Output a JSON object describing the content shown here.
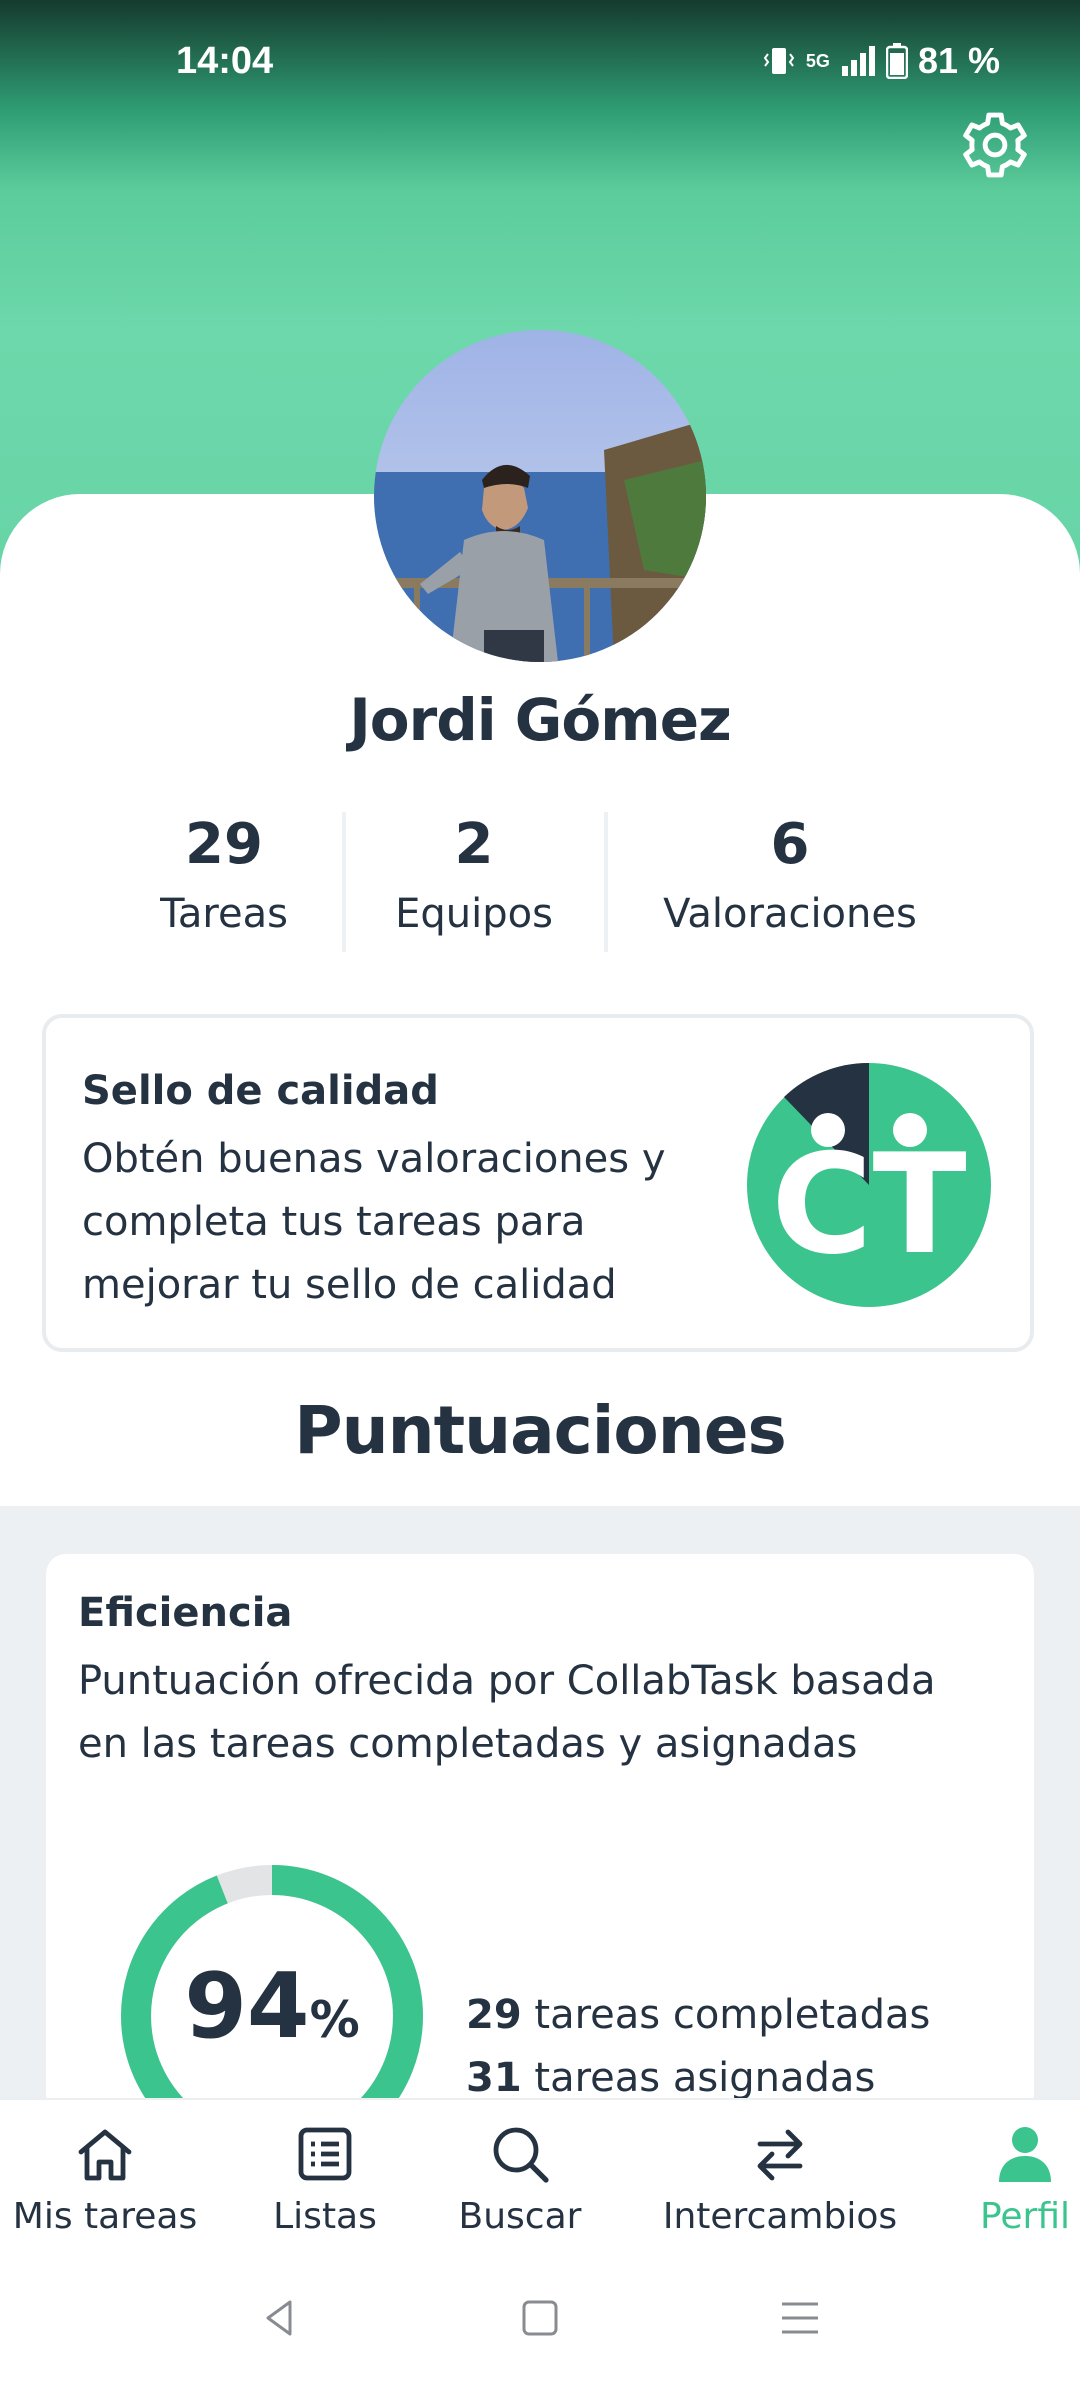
{
  "status_bar": {
    "time": "14:04",
    "network": "5G",
    "battery": "81 %"
  },
  "profile": {
    "name": "Jordi Gómez"
  },
  "stats": [
    {
      "value": "29",
      "label": "Tareas"
    },
    {
      "value": "2",
      "label": "Equipos"
    },
    {
      "value": "6",
      "label": "Valoraciones"
    }
  ],
  "quality_card": {
    "title": "Sello de calidad",
    "description": "Obtén buenas valoraciones y completa tus tareas para mejorar tu sello de calidad",
    "logo_text": "CT"
  },
  "scores_section": {
    "title": "Puntuaciones"
  },
  "efficiency_card": {
    "title": "Eficiencia",
    "description": "Puntuación ofrecida por CollabTask basada en las tareas completadas y asignadas",
    "percent_value": "94",
    "percent_sign": "%",
    "completed_count": "29",
    "completed_label": " tareas completadas",
    "assigned_count": "31",
    "assigned_label": " tareas asignadas"
  },
  "bottom_nav": {
    "items": [
      {
        "label": "Mis tareas",
        "icon": "home-icon"
      },
      {
        "label": "Listas",
        "icon": "list-icon"
      },
      {
        "label": "Buscar",
        "icon": "search-icon"
      },
      {
        "label": "Intercambios",
        "icon": "swap-icon"
      },
      {
        "label": "Perfil",
        "icon": "person-icon",
        "active": true
      }
    ]
  },
  "colors": {
    "accent": "#3cc48e",
    "text": "#253241",
    "logo_dark": "#253241"
  }
}
